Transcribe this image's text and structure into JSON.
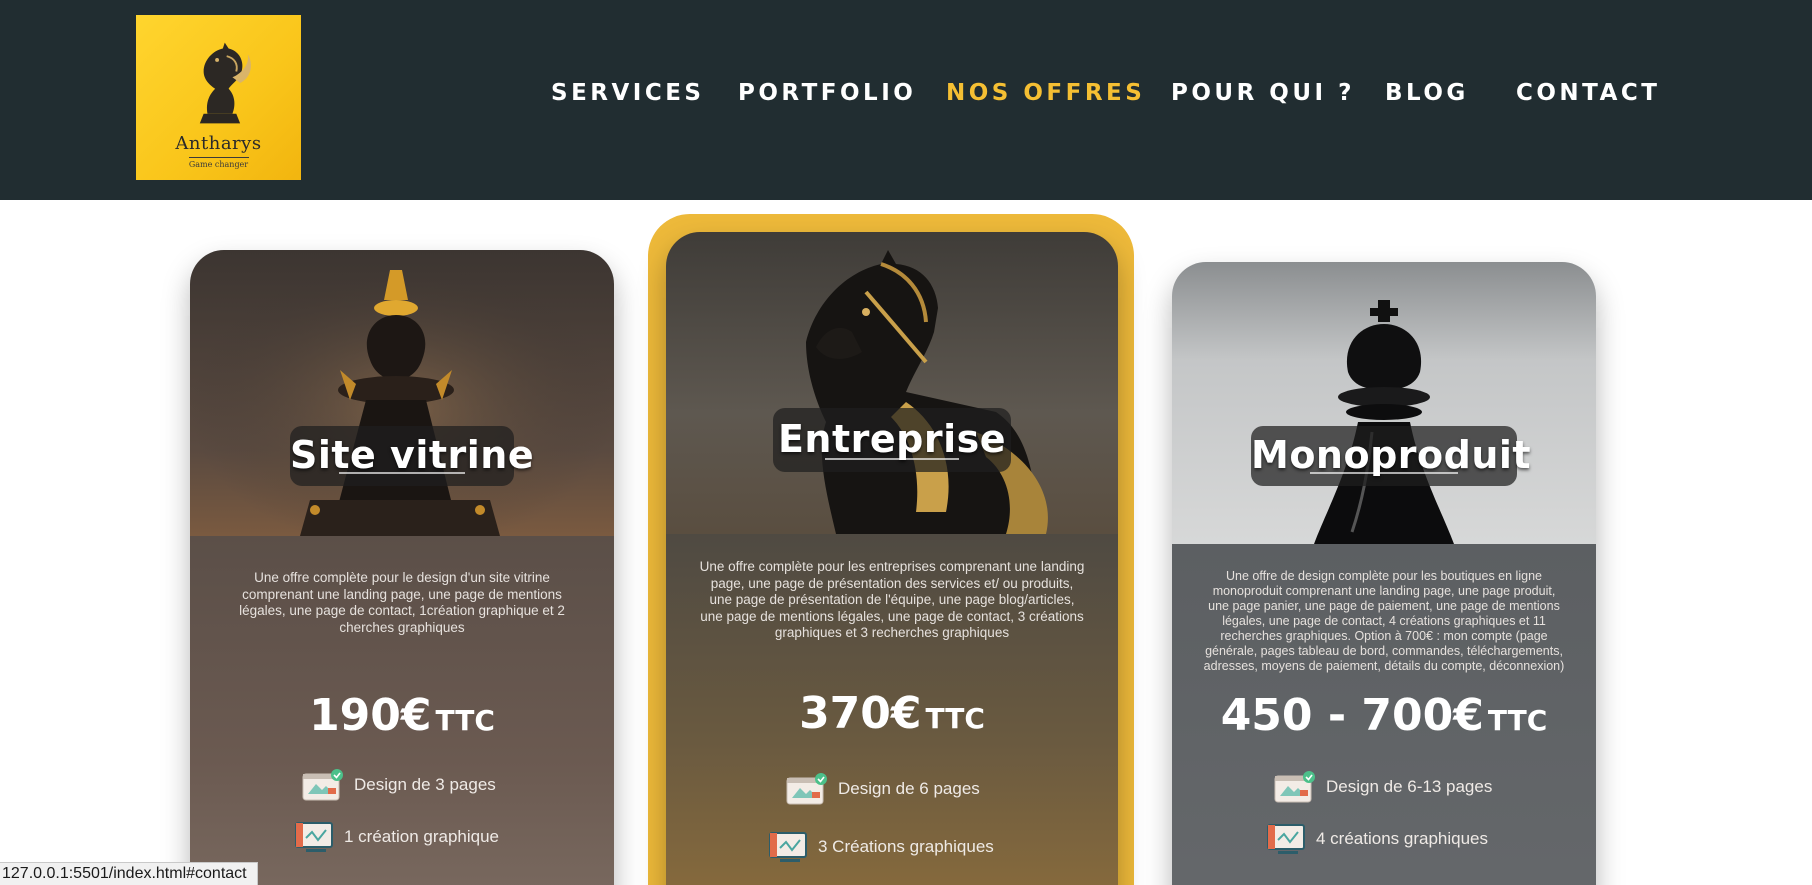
{
  "brand": {
    "name": "Antharys",
    "tagline": "Game changer"
  },
  "nav": {
    "items": [
      {
        "label": "SERVICES"
      },
      {
        "label": "PORTFOLIO"
      },
      {
        "label": "NOS OFFRES",
        "active": true
      },
      {
        "label": "POUR QUI ?"
      },
      {
        "label": "BLOG"
      },
      {
        "label": "CONTACT"
      }
    ]
  },
  "colors": {
    "header_bg": "#212d31",
    "accent": "#f5bf33",
    "logo_bg": "#fcc920"
  },
  "offers": [
    {
      "title": "Site vitrine",
      "icon": "chess-bishop-gold",
      "description": "Une offre complète pour le design d'un site vitrine comprenant une landing page, une page de mentions légales, une page de contact, 1création graphique et 2 cherches graphiques",
      "price": "190€",
      "price_suffix": "TTC",
      "features": [
        "Design de 3 pages",
        "1 création graphique"
      ]
    },
    {
      "title": "Entreprise",
      "icon": "chess-knight-gold",
      "description": "Une offre complète pour les entreprises comprenant une landing page, une page de présentation des services et/ ou produits, une page de présentation de l'équipe, une page blog/articles, une page de mentions légales, une page de contact, 3 créations graphiques et 3 recherches graphiques",
      "price": "370€",
      "price_suffix": "TTC",
      "features": [
        "Design de 6 pages",
        "3 Créations graphiques"
      ]
    },
    {
      "title": "Monoproduit",
      "icon": "chess-queen-black",
      "description": "Une offre de design complète pour les boutiques en ligne monoproduit comprenant une landing page, une page produit, une page panier, une page de paiement, une page de mentions légales, une page de contact, 4 créations graphiques et 11 recherches graphiques. Option à 700€ : mon compte (page générale, pages tableau de bord, commandes, téléchargements, adresses, moyens de paiement, détails du compte, déconnexion)",
      "price": "450 - 700€",
      "price_suffix": "TTC",
      "features": [
        "Design de 6-13 pages",
        "4 créations graphiques"
      ]
    }
  ],
  "status_url": "127.0.0.1:5501/index.html#contact"
}
